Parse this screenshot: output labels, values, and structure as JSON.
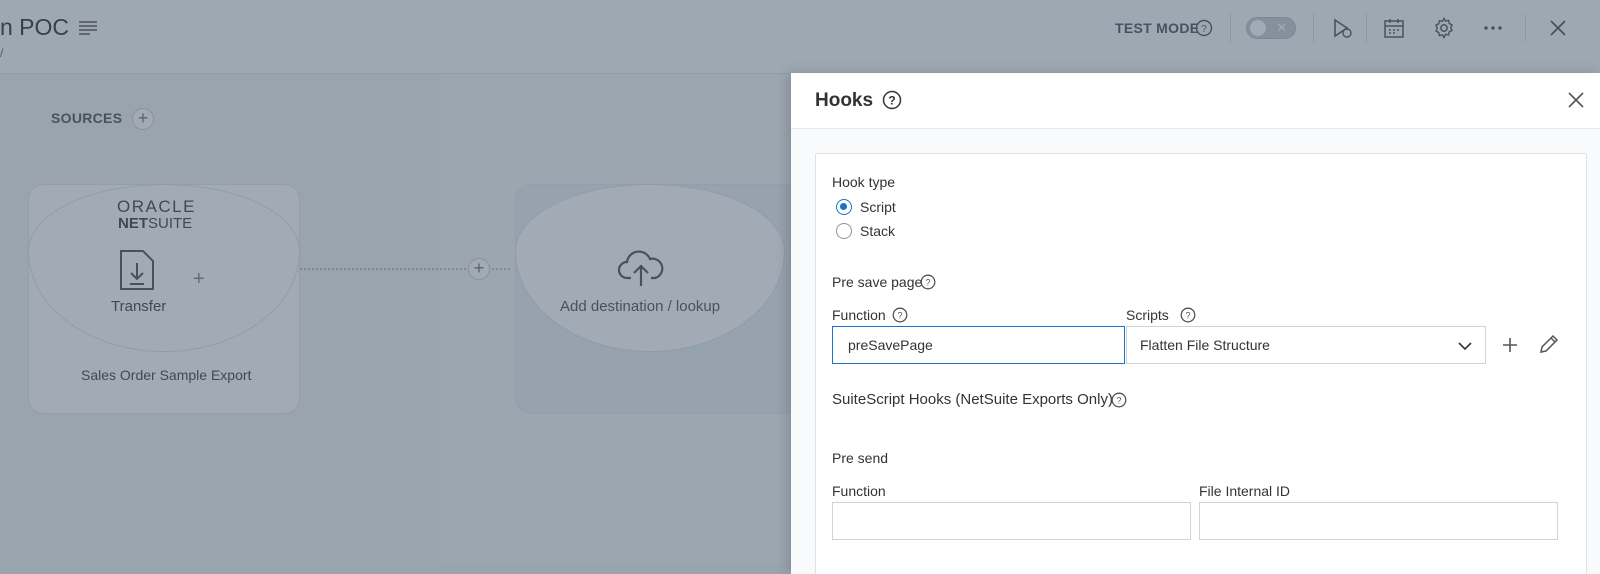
{
  "header": {
    "app_title": "n POC",
    "subtitle": "/",
    "test_mode_label": "TEST MODE"
  },
  "canvas": {
    "sources_label": "SOURCES",
    "source_brand_top": "ORACLE",
    "source_brand_bottom_bold": "NET",
    "source_brand_bottom_rest": "SUITE",
    "source_action_label": "Transfer",
    "source_export_name": "Sales Order Sample Export",
    "destination_label": "Add destination / lookup"
  },
  "drawer": {
    "title": "Hooks",
    "hook_type_label": "Hook type",
    "hook_type_options": [
      {
        "label": "Script",
        "selected": true
      },
      {
        "label": "Stack",
        "selected": false
      }
    ],
    "pre_save_label": "Pre save page",
    "function_label": "Function",
    "function_value": "preSavePage",
    "scripts_label": "Scripts",
    "scripts_value": "Flatten File Structure",
    "suitescript_label": "SuiteScript Hooks (NetSuite Exports Only)",
    "pre_send_label": "Pre send",
    "pre_send_function_label": "Function",
    "pre_send_function_value": "",
    "file_internal_id_label": "File Internal ID",
    "file_internal_id_value": ""
  },
  "colors": {
    "accent": "#1a73c8",
    "overlay": "#3c5064"
  }
}
